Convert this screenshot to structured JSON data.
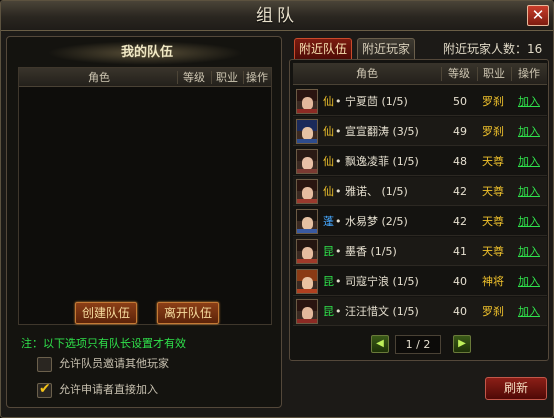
{
  "window": {
    "title": "组队"
  },
  "my_team": {
    "heading": "我的队伍",
    "columns": [
      "角色",
      "等级",
      "职业",
      "操作"
    ],
    "create_label": "创建队伍",
    "leave_label": "离开队伍",
    "notice": "注：以下选项只有队长设置才有效",
    "options": [
      {
        "label": "允许队员邀请其他玩家",
        "checked": false
      },
      {
        "label": "允许申请者直接加入",
        "checked": true
      }
    ]
  },
  "tabs": [
    {
      "label": "附近队伍",
      "active": true
    },
    {
      "label": "附近玩家",
      "active": false
    }
  ],
  "nearby_count": "附近玩家人数：16",
  "nearby": {
    "columns": [
      "角色",
      "等级",
      "职业",
      "操作"
    ],
    "players": [
      {
        "faction": "仙",
        "faction_color": "#f0c22c",
        "name": "• 宁夏茴 (1/5)",
        "level": "50",
        "class": "罗刹",
        "action": "加入"
      },
      {
        "faction": "仙",
        "faction_color": "#f0c22c",
        "name": "• 宣宣翻涛 (3/5)",
        "level": "49",
        "class": "罗刹",
        "action": "加入"
      },
      {
        "faction": "仙",
        "faction_color": "#f0c22c",
        "name": "• 飘逸凌菲 (1/5)",
        "level": "48",
        "class": "天尊",
        "action": "加入"
      },
      {
        "faction": "仙",
        "faction_color": "#f0c22c",
        "name": "• 雅诺、 (1/5)",
        "level": "42",
        "class": "天尊",
        "action": "加入"
      },
      {
        "faction": "蓬",
        "faction_color": "#46a8ff",
        "name": "• 水易梦 (2/5)",
        "level": "42",
        "class": "天尊",
        "action": "加入"
      },
      {
        "faction": "昆",
        "faction_color": "#2fe24b",
        "name": "• 墨香 (1/5)",
        "level": "41",
        "class": "天尊",
        "action": "加入"
      },
      {
        "faction": "昆",
        "faction_color": "#2fe24b",
        "name": "• 司寇宁浪 (1/5)",
        "level": "40",
        "class": "神将",
        "action": "加入"
      },
      {
        "faction": "昆",
        "faction_color": "#2fe24b",
        "name": "• 汪汪惜文 (1/5)",
        "level": "40",
        "class": "罗刹",
        "action": "加入"
      }
    ]
  },
  "pager": {
    "prev": "◀",
    "next": "▶",
    "page": "1 / 2"
  },
  "refresh_label": "刷新",
  "colors": {
    "accent_red": "#8b1f17",
    "join_green": "#2fe24b",
    "class_gold": "#f0c22c"
  }
}
